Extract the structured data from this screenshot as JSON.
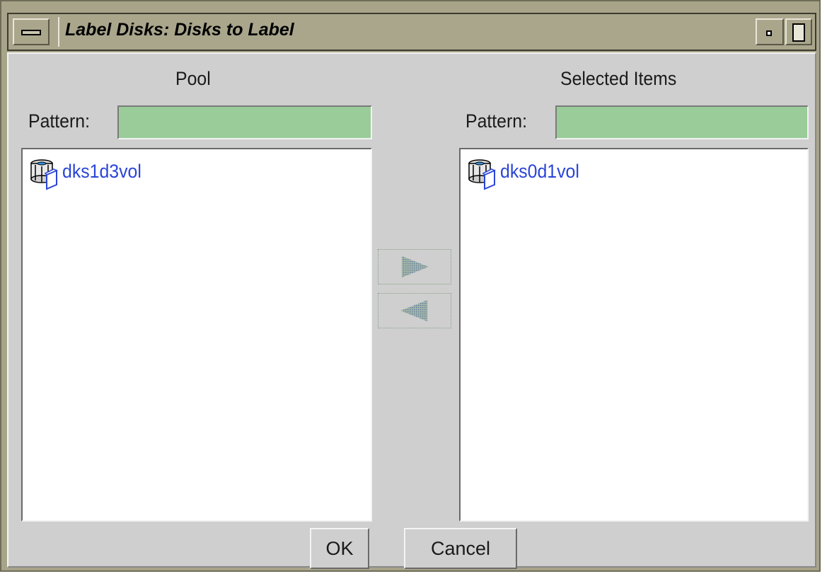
{
  "window": {
    "title": "Label Disks: Disks to Label"
  },
  "pool": {
    "heading": "Pool",
    "pattern_label": "Pattern:",
    "pattern_value": "",
    "items": [
      {
        "label": "dks1d3vol",
        "icon": "disk-volume-icon"
      }
    ]
  },
  "selected": {
    "heading": "Selected Items",
    "pattern_label": "Pattern:",
    "pattern_value": "",
    "items": [
      {
        "label": "dks0d1vol",
        "icon": "disk-volume-icon"
      }
    ]
  },
  "buttons": {
    "ok_label": "OK",
    "cancel_label": "Cancel"
  },
  "colors": {
    "window_frame": "#a8a48a",
    "dialog_bg": "#cfcfcf",
    "pattern_field": "#99cc99",
    "item_text": "#2a44d8"
  }
}
